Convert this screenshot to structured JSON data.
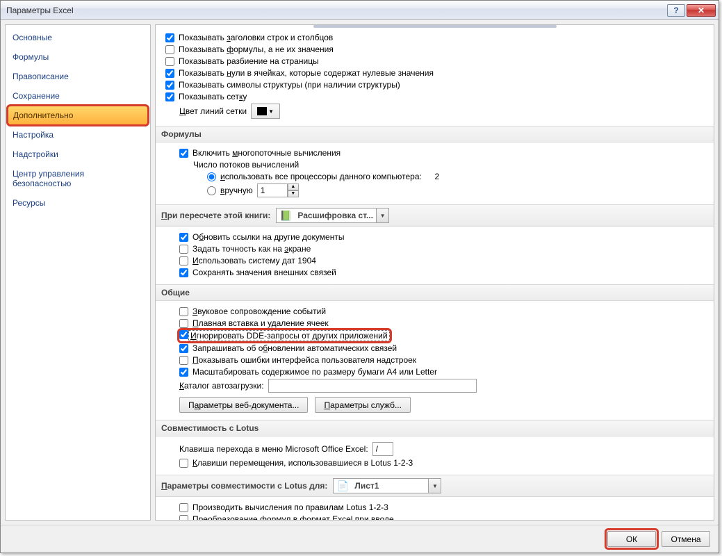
{
  "window": {
    "title": "Параметры Excel"
  },
  "sidebar": {
    "items": [
      {
        "label": "Основные"
      },
      {
        "label": "Формулы"
      },
      {
        "label": "Правописание"
      },
      {
        "label": "Сохранение"
      },
      {
        "label": "Дополнительно"
      },
      {
        "label": "Настройка"
      },
      {
        "label": "Надстройки"
      },
      {
        "label": "Центр управления безопасностью"
      },
      {
        "label": "Ресурсы"
      }
    ]
  },
  "display": {
    "show_headers": "Показывать заголовки строк и столбцов",
    "show_formulas": "Показывать формулы, а не их значения",
    "show_pagebreaks": "Показывать разбиение на страницы",
    "show_zeros": "Показывать нули в ячейках, которые содержат нулевые значения",
    "show_outline": "Показывать символы структуры (при наличии структуры)",
    "show_grid": "Показывать сетку",
    "grid_color_label": "Цвет линий сетки"
  },
  "formulas": {
    "title": "Формулы",
    "multi_thread": "Включить многопоточные вычисления",
    "threads_label": "Число потоков вычислений",
    "use_all": "использовать все процессоры данного компьютера:",
    "cpu_count": "2",
    "manual": "вручную",
    "manual_val": "1"
  },
  "recalc": {
    "title": "При пересчете этой книги:",
    "book": "Расшифровка ст...",
    "update_links": "Обновить ссылки на другие документы",
    "precision": "Задать точность как на экране",
    "date1904": "Использовать систему дат 1904",
    "save_ext": "Сохранять значения внешних связей"
  },
  "general": {
    "title": "Общие",
    "sound": "Звуковое сопровождение событий",
    "smooth_ins": "Плавная вставка и удаление ячеек",
    "ignore_dde": "Игнорировать DDE-запросы от других приложений",
    "ask_update": "Запрашивать об обновлении автоматических связей",
    "show_addin_err": "Показывать ошибки интерфейса пользователя надстроек",
    "scale_a4": "Масштабировать содержимое по размеру бумаги А4 или Letter",
    "startup_label": "Каталог автозагрузки:",
    "web_params": "Параметры веб-документа...",
    "service_params": "Параметры служб..."
  },
  "lotus": {
    "title": "Совместимость с Lotus",
    "menu_key_label": "Клавиша перехода в меню Microsoft Office Excel:",
    "menu_key": "/",
    "nav_keys": "Клавиши перемещения, использовавшиеся в Lotus 1-2-3"
  },
  "lotus_params": {
    "title": "Параметры совместимости с Lotus для:",
    "sheet": "Лист1",
    "calc_rules": "Производить вычисления по правилам Lotus 1-2-3",
    "convert_formulas": "Преобразование формул в формат Excel при вводе"
  },
  "footer": {
    "ok": "ОК",
    "cancel": "Отмена"
  }
}
